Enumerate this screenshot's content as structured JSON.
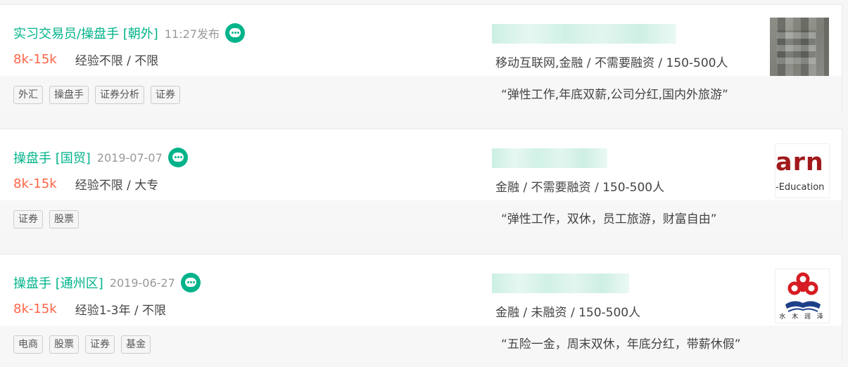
{
  "jobs": [
    {
      "title": "实习交易员/操盘手 [朝外]",
      "time": "11:27发布",
      "salary": "8k-15k",
      "requirements": "经验不限 / 不限",
      "industry": "移动互联网,金融 / 不需要融资 / 150-500人",
      "tags": [
        "外汇",
        "操盘手",
        "证券分析",
        "证券"
      ],
      "slogan": "“弹性工作,年底双薪,公司分红,国内外旅游”"
    },
    {
      "title": "操盘手 [国贸]",
      "time": "2019-07-07",
      "salary": "8k-15k",
      "requirements": "经验不限 / 大专",
      "industry": "金融 / 不需要融资 / 150-500人",
      "tags": [
        "证券",
        "股票"
      ],
      "slogan": "“弹性工作，双休，员工旅游，财富自由”",
      "logo_text": "arn",
      "logo_subtext": "-Education"
    },
    {
      "title": "操盘手 [通州区]",
      "time": "2019-06-27",
      "salary": "8k-15k",
      "requirements": "经验1-3年 / 不限",
      "industry": "金融 / 未融资 / 150-500人",
      "tags": [
        "电商",
        "股票",
        "证券",
        "基金"
      ],
      "slogan": "“五险一金，周末双休，年底分红，带薪休假”",
      "logo_text": "水 木 润 泽"
    }
  ],
  "colors": {
    "accent": "#00b38a",
    "salary": "#ff6445",
    "muted": "#999999"
  },
  "icons": {
    "chat": "chat-bubble-icon"
  }
}
